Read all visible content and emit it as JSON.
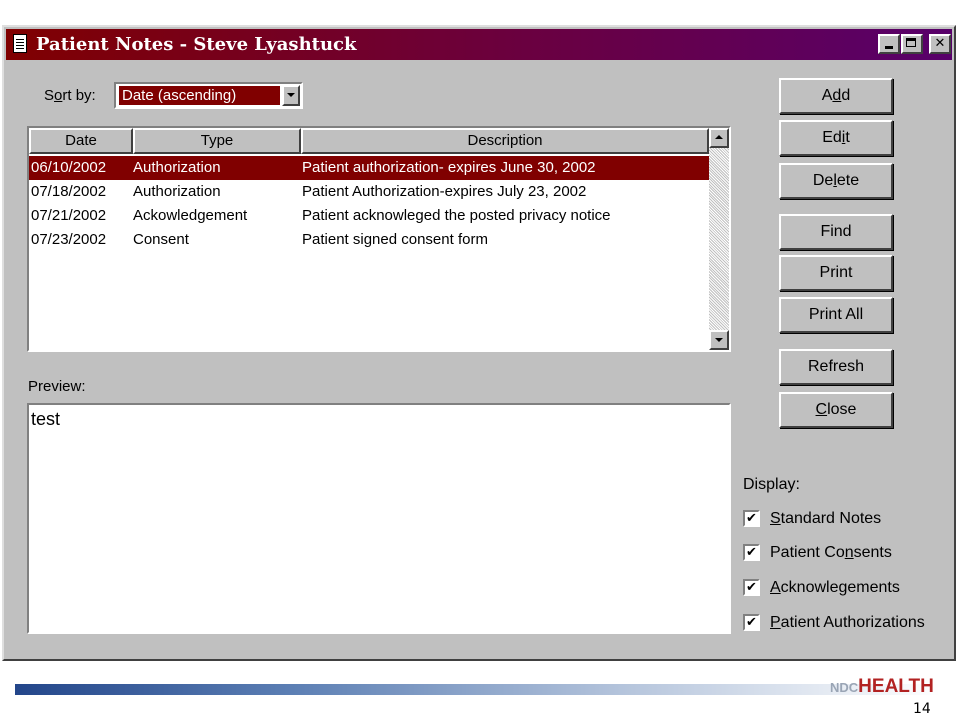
{
  "window": {
    "title": "Patient Notes - Steve Lyashtuck",
    "controls": {
      "minimize": "_",
      "maximize": "□",
      "close": "✕"
    }
  },
  "sort": {
    "label_pre": "S",
    "label_key": "o",
    "label_post": "rt by:",
    "selected": "Date (ascending)"
  },
  "list": {
    "columns": [
      "Date",
      "Type",
      "Description"
    ],
    "rows": [
      {
        "date": "06/10/2002",
        "type": "Authorization",
        "description": "Patient authorization- expires June 30, 2002",
        "selected": true
      },
      {
        "date": "07/18/2002",
        "type": "Authorization",
        "description": "Patient Authorization-expires July 23, 2002"
      },
      {
        "date": "07/21/2002",
        "type": "Ackowledgement",
        "description": "Patient acknowleged the posted privacy notice"
      },
      {
        "date": "07/23/2002",
        "type": "Consent",
        "description": "Patient signed consent form"
      }
    ]
  },
  "preview": {
    "label": "Preview:",
    "text": "test"
  },
  "buttons": {
    "add": {
      "pre": "A",
      "key": "d",
      "post": "d"
    },
    "edit": {
      "pre": "Ed",
      "key": "i",
      "post": "t"
    },
    "delete": {
      "pre": "De",
      "key": "l",
      "post": "ete"
    },
    "find": {
      "pre": "",
      "key": "",
      "post": "Find"
    },
    "print": {
      "pre": "",
      "key": "",
      "post": "Print"
    },
    "print_all": {
      "pre": "",
      "key": "",
      "post": "Print All"
    },
    "refresh": {
      "pre": "",
      "key": "",
      "post": "Refresh"
    },
    "close": {
      "pre": "",
      "key": "C",
      "post": "lose"
    }
  },
  "display": {
    "label": "Display:",
    "options": [
      {
        "pre": "",
        "key": "S",
        "post": "tandard Notes",
        "checked": true
      },
      {
        "pre": "Patient Co",
        "key": "n",
        "post": "sents",
        "checked": true
      },
      {
        "pre": "",
        "key": "A",
        "post": "cknowlegements",
        "checked": true
      },
      {
        "pre": "",
        "key": "P",
        "post": "atient Authorizations",
        "checked": true
      }
    ],
    "check_glyph": "✔"
  },
  "footer": {
    "logo_ndc": "NDC",
    "logo_health": "HEALTH",
    "page_number": "14"
  },
  "colors": {
    "selection": "#800000",
    "title_gradient_start": "#800000",
    "title_gradient_end": "#58006a",
    "window_face": "#c0c0c0"
  }
}
